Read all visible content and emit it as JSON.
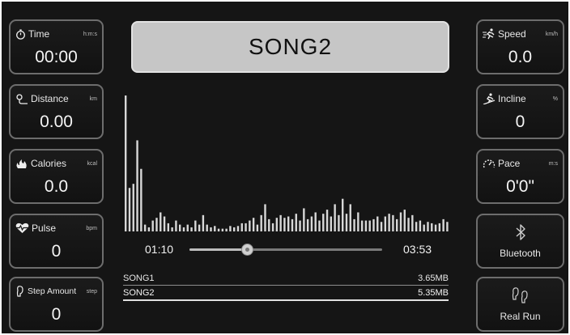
{
  "song_title": "SONG2",
  "stats": {
    "time": {
      "label": "Time",
      "unit": "h:m:s",
      "value": "00:00",
      "icon": "stopwatch-icon"
    },
    "distance": {
      "label": "Distance",
      "unit": "km",
      "value": "0.00",
      "icon": "distance-icon"
    },
    "calories": {
      "label": "Calories",
      "unit": "kcal",
      "value": "0.0",
      "icon": "flame-icon"
    },
    "pulse": {
      "label": "Pulse",
      "unit": "bpm",
      "value": "0",
      "icon": "heart-pulse-icon"
    },
    "step_amount": {
      "label": "Step Amount",
      "unit": "step",
      "value": "0",
      "icon": "footprint-icon"
    },
    "speed": {
      "label": "Speed",
      "unit": "km/h",
      "value": "0.0",
      "icon": "runner-speed-icon"
    },
    "incline": {
      "label": "Incline",
      "unit": "%",
      "value": "0",
      "icon": "runner-incline-icon"
    },
    "pace": {
      "label": "Pace",
      "unit": "m:s",
      "value": "0'0\"",
      "icon": "gauge-icon"
    }
  },
  "actions": {
    "bluetooth": {
      "label": "Bluetooth",
      "icon": "bluetooth-icon"
    },
    "real_run": {
      "label": "Real Run",
      "icon": "footprints-icon"
    }
  },
  "player": {
    "elapsed": "01:10",
    "total": "03:53",
    "progress": 0.3
  },
  "equalizer_levels": [
    1.0,
    0.32,
    0.35,
    0.67,
    0.46,
    0.05,
    0.03,
    0.08,
    0.1,
    0.14,
    0.11,
    0.06,
    0.03,
    0.08,
    0.05,
    0.03,
    0.05,
    0.03,
    0.08,
    0.05,
    0.12,
    0.05,
    0.03,
    0.04,
    0.02,
    0.02,
    0.02,
    0.04,
    0.03,
    0.04,
    0.06,
    0.06,
    0.08,
    0.1,
    0.05,
    0.12,
    0.2,
    0.09,
    0.06,
    0.1,
    0.12,
    0.1,
    0.11,
    0.09,
    0.13,
    0.08,
    0.17,
    0.09,
    0.11,
    0.14,
    0.08,
    0.13,
    0.16,
    0.11,
    0.2,
    0.12,
    0.24,
    0.13,
    0.2,
    0.09,
    0.14,
    0.08,
    0.08,
    0.08,
    0.09,
    0.11,
    0.07,
    0.11,
    0.13,
    0.12,
    0.09,
    0.14,
    0.16,
    0.1,
    0.12,
    0.07,
    0.08,
    0.05,
    0.07,
    0.06,
    0.05,
    0.06,
    0.09,
    0.07
  ],
  "playlist": [
    {
      "name": "SONG1",
      "size": "3.65MB",
      "active": false
    },
    {
      "name": "SONG2",
      "size": "5.35MB",
      "active": true
    }
  ],
  "colors": {
    "background": "#151515",
    "tile_border": "#6d6d6d",
    "title_box": "#c6c6c6"
  }
}
